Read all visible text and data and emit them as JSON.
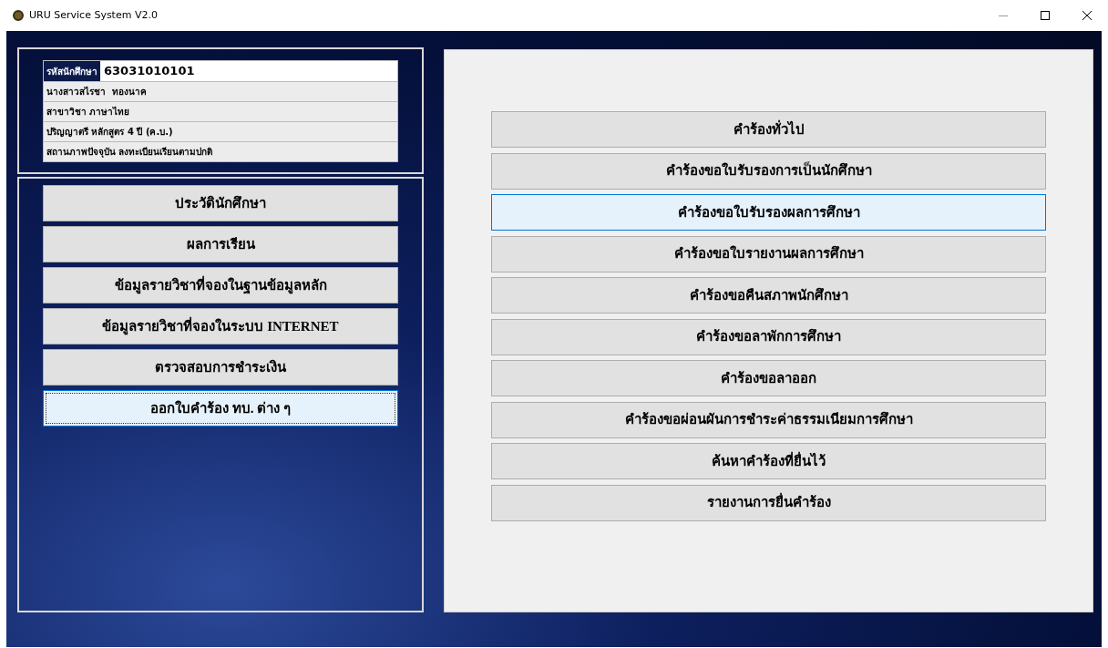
{
  "window": {
    "title": "URU Service System V2.0"
  },
  "student": {
    "id_label": "รหัสนักศึกษา",
    "id_value": "63031010101",
    "lines": [
      "นางสาวสไรชา  ทองนาค",
      "สาขาวิชา ภาษาไทย",
      "ปริญญาตรี หลักสูตร 4 ปี (ค.บ.)",
      "สถานภาพปัจจุบัน ลงทะเบียนเรียนตามปกติ"
    ]
  },
  "menu": [
    {
      "label": "ประวัตินักศึกษา",
      "selected": false
    },
    {
      "label": "ผลการเรียน",
      "selected": false
    },
    {
      "label": "ข้อมูลรายวิชาที่จองในฐานข้อมูลหลัก",
      "selected": false
    },
    {
      "label": "ข้อมูลรายวิชาที่จองในระบบ INTERNET",
      "selected": false
    },
    {
      "label": "ตรวจสอบการชำระเงิน",
      "selected": false
    },
    {
      "label": "ออกใบคำร้อง ทบ. ต่าง ๆ",
      "selected": true
    }
  ],
  "requests": [
    {
      "label": "คำร้องทั่วไป",
      "selected": false
    },
    {
      "label": "คำร้องขอใบรับรองการเป็นนักศึกษา",
      "selected": false
    },
    {
      "label": "คำร้องขอใบรับรองผลการศึกษา",
      "selected": true
    },
    {
      "label": "คำร้องขอใบรายงานผลการศึกษา",
      "selected": false
    },
    {
      "label": "คำร้องขอคืนสภาพนักศึกษา",
      "selected": false
    },
    {
      "label": "คำร้องขอลาพักการศึกษา",
      "selected": false
    },
    {
      "label": "คำร้องขอลาออก",
      "selected": false
    },
    {
      "label": "คำร้องขอผ่อนผันการชำระค่าธรรมเนียมการศึกษา",
      "selected": false
    },
    {
      "label": "ค้นหาคำร้องที่ยื่นไว้",
      "selected": false
    },
    {
      "label": "รายงานการยื่นคำร้อง",
      "selected": false
    }
  ]
}
